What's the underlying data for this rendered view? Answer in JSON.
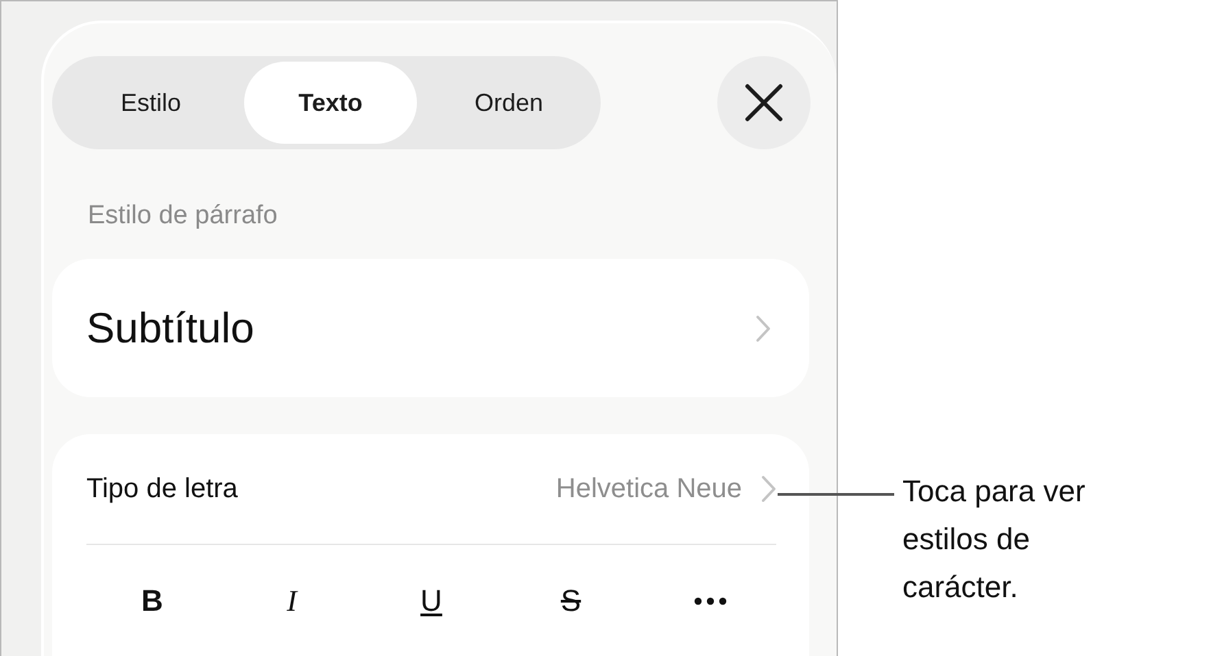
{
  "tabs": [
    {
      "label": "Estilo",
      "selected": false
    },
    {
      "label": "Texto",
      "selected": true
    },
    {
      "label": "Orden",
      "selected": false
    }
  ],
  "section_title": "Estilo de párrafo",
  "paragraph_style": {
    "value": "Subtítulo"
  },
  "font_row": {
    "label": "Tipo de letra",
    "value": "Helvetica Neue"
  },
  "format_buttons": [
    {
      "kind": "bold",
      "label": "B"
    },
    {
      "kind": "italic",
      "label": "I"
    },
    {
      "kind": "underline",
      "label": "U"
    },
    {
      "kind": "strike",
      "label": "S"
    },
    {
      "kind": "more"
    }
  ],
  "callout": {
    "text": "Toca para ver estilos de carácter."
  }
}
